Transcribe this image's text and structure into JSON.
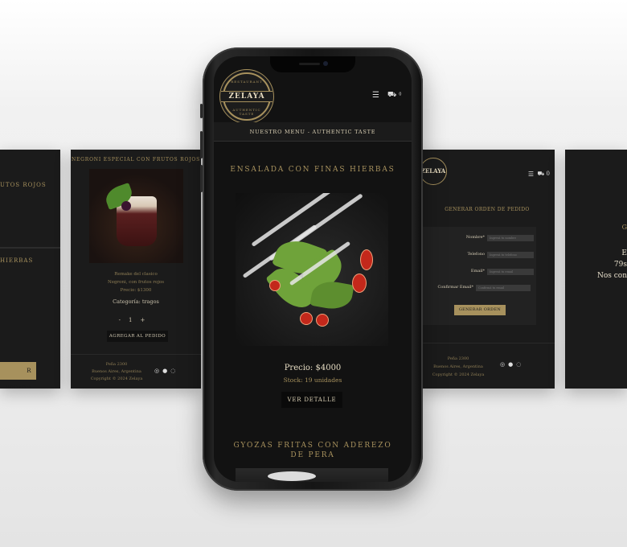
{
  "far_left_card": {
    "title_fragment": "UTOS ROJOS",
    "title2_fragment": "HIERBAS",
    "button_fragment": "R PEDIDO"
  },
  "left_card": {
    "title": "NEGRONI ESPECIAL CON FRUTOS ROJOS",
    "desc_line1": "Remake del clasico",
    "desc_line2": "Negroni, con frutos rojos",
    "desc_line3": "Precio: $1300",
    "category": "Categoría: tragos",
    "qty_minus": "-",
    "qty_value": "1",
    "qty_plus": "+",
    "add_button": "AGREGAR AL PEDIDO",
    "footer_line1": "Peña 2300",
    "footer_line2": "Buenos Aires, Argentina",
    "footer_line3": "Copyright © 2024 Zelaya",
    "social_icons": [
      "instagram-icon",
      "facebook-icon",
      "whatsapp-icon"
    ]
  },
  "phone": {
    "logo_text": "ZELAYA",
    "logo_top": "RESTAURANT",
    "logo_bottom": "AUTHENTIC TASTE",
    "cart_count": "0",
    "section_band": "NUESTRO MENU - AUTHENTIC TASTE",
    "product1_title": "ENSALADA CON FINAS HIERBAS",
    "product1_price": "Precio: $4000",
    "product1_stock": "Stock: 19 unidades",
    "product1_button": "VER DETALLE",
    "product2_title": "GYOZAS FRITAS CON ADEREZO DE PERA"
  },
  "right_card": {
    "logo_text": "ZELAYA",
    "cart_count": "0",
    "form_title": "GENERAR ORDEN DE PEDIDO",
    "fields": [
      {
        "label": "Nombre*",
        "placeholder": "Ingresá tu nombre"
      },
      {
        "label": "Telefono",
        "placeholder": "Ingresá tu telefono"
      },
      {
        "label": "Email*",
        "placeholder": "Ingresá tu email"
      },
      {
        "label": "Confirmar Email*",
        "placeholder": "Confirmá tu email"
      }
    ],
    "submit": "GENERAR ORDEN",
    "footer_line1": "Peña 2300",
    "footer_line2": "Buenos Aires, Argentina",
    "footer_line3": "Copyright © 2024 Zelaya"
  },
  "far_right_card": {
    "line_a": "G",
    "line_b1": "E",
    "line_b2": "79s",
    "line_b3": "Nos con"
  },
  "colors": {
    "gold": "#a7915d",
    "card_bg": "#1b1b1b",
    "screen_bg": "#121212"
  }
}
